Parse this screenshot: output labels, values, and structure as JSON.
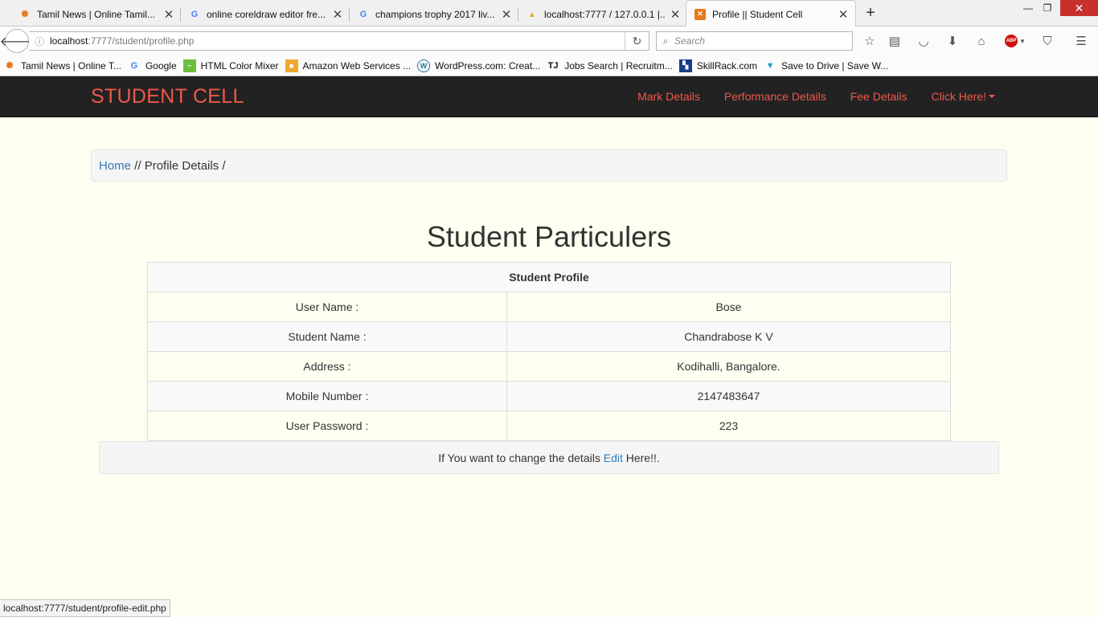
{
  "browser": {
    "tabs": [
      {
        "title": "Tamil News | Online Tamil...",
        "favicon": "orange-logo-icon"
      },
      {
        "title": "online coreldraw editor fre...",
        "favicon": "google-icon"
      },
      {
        "title": "champions trophy 2017 liv...",
        "favicon": "google-icon"
      },
      {
        "title": "localhost:7777 / 127.0.0.1 |...",
        "favicon": "phpmyadmin-icon"
      },
      {
        "title": "Profile || Student Cell",
        "favicon": "xampp-icon",
        "active": true
      }
    ],
    "url_host": "localhost",
    "url_path": ":7777/student/profile.php",
    "search_placeholder": "Search",
    "bookmarks": [
      {
        "label": "Tamil News | Online T...",
        "icon": "orange-logo-icon"
      },
      {
        "label": "Google",
        "icon": "google-icon"
      },
      {
        "label": "HTML Color Mixer",
        "icon": "color-mixer-icon"
      },
      {
        "label": "Amazon Web Services ...",
        "icon": "box-icon"
      },
      {
        "label": "WordPress.com: Creat...",
        "icon": "wordpress-icon"
      },
      {
        "label": "Jobs Search | Recruitm...",
        "icon": "tj-logo-icon"
      },
      {
        "label": "SkillRack.com",
        "icon": "skillrack-icon"
      },
      {
        "label": "Save to Drive | Save W...",
        "icon": "shield-icon"
      }
    ],
    "status_url": "localhost:7777/student/profile-edit.php"
  },
  "site": {
    "brand": "STUDENT CELL",
    "nav": [
      "Mark Details",
      "Performance Details",
      "Fee Details",
      "Click Here!"
    ]
  },
  "breadcrumb": {
    "home": "Home",
    "sep1": " // ",
    "current": "Profile Details",
    "sep2": " /"
  },
  "page_title": "Student Particulers",
  "profile": {
    "header": "Student Profile",
    "rows": [
      {
        "label": "User Name :",
        "value": "Bose"
      },
      {
        "label": "Student Name :",
        "value": "Chandrabose K V"
      },
      {
        "label": "Address :",
        "value": "Kodihalli, Bangalore."
      },
      {
        "label": "Mobile Number :",
        "value": "2147483647"
      },
      {
        "label": "User Password :",
        "value": "223"
      }
    ]
  },
  "edit_note": {
    "before": "If You want to change the details ",
    "link": "Edit",
    "after": " Here!!."
  },
  "colors": {
    "brand": "#f0584c",
    "navbar_bg": "#222222",
    "page_bg": "#fefff0",
    "link": "#337ab7",
    "window_close": "#c7302b"
  }
}
